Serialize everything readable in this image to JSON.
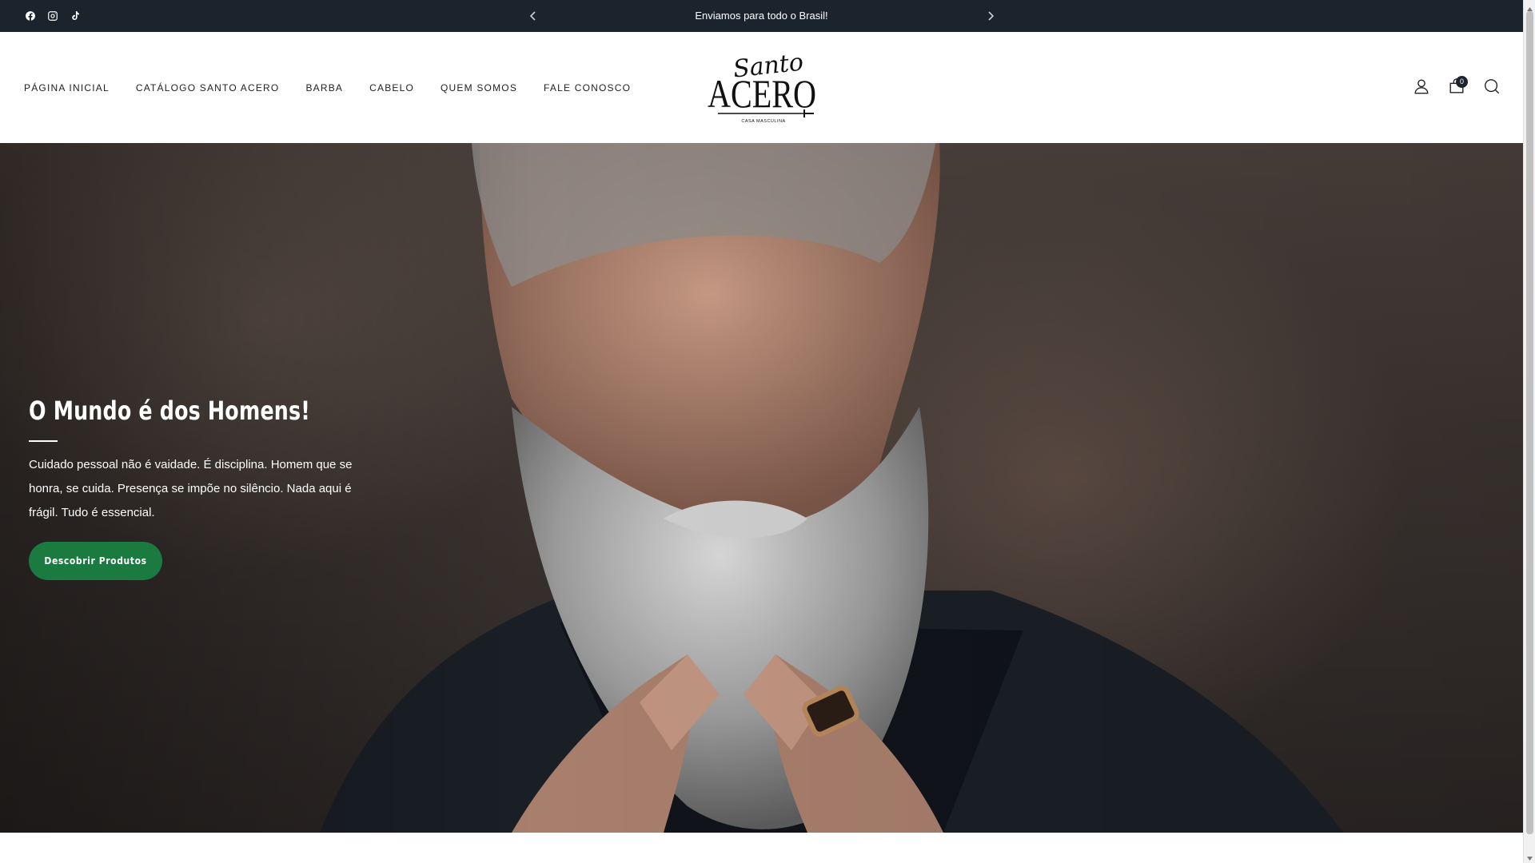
{
  "announcement": {
    "message": "Enviamos para todo o Brasil!",
    "social_icons": [
      "facebook-icon",
      "instagram-icon",
      "tiktok-icon"
    ]
  },
  "nav": {
    "items": [
      {
        "label": "PÁGINA INICIAL"
      },
      {
        "label": "CATÁLOGO SANTO ACERO"
      },
      {
        "label": "BARBA"
      },
      {
        "label": "CABELO"
      },
      {
        "label": "QUEM SOMOS"
      },
      {
        "label": "FALE CONOSCO"
      }
    ]
  },
  "logo": {
    "script_text": "Santo",
    "main_text": "ACERO",
    "tagline": "CASA MASCULINA"
  },
  "header_icons": {
    "cart_count": "0"
  },
  "hero": {
    "title": "O Mundo é dos Homens!",
    "text": "Cuidado pessoal não é vaidade. É disciplina. Homem que se honra, se cuida. Presença se impõe no silêncio. Nada aqui é frágil. Tudo é essencial.",
    "button_label": "Descobrir Produtos"
  },
  "colors": {
    "announcement_bg": "#1b232c",
    "button_bg": "#1a7a40"
  }
}
